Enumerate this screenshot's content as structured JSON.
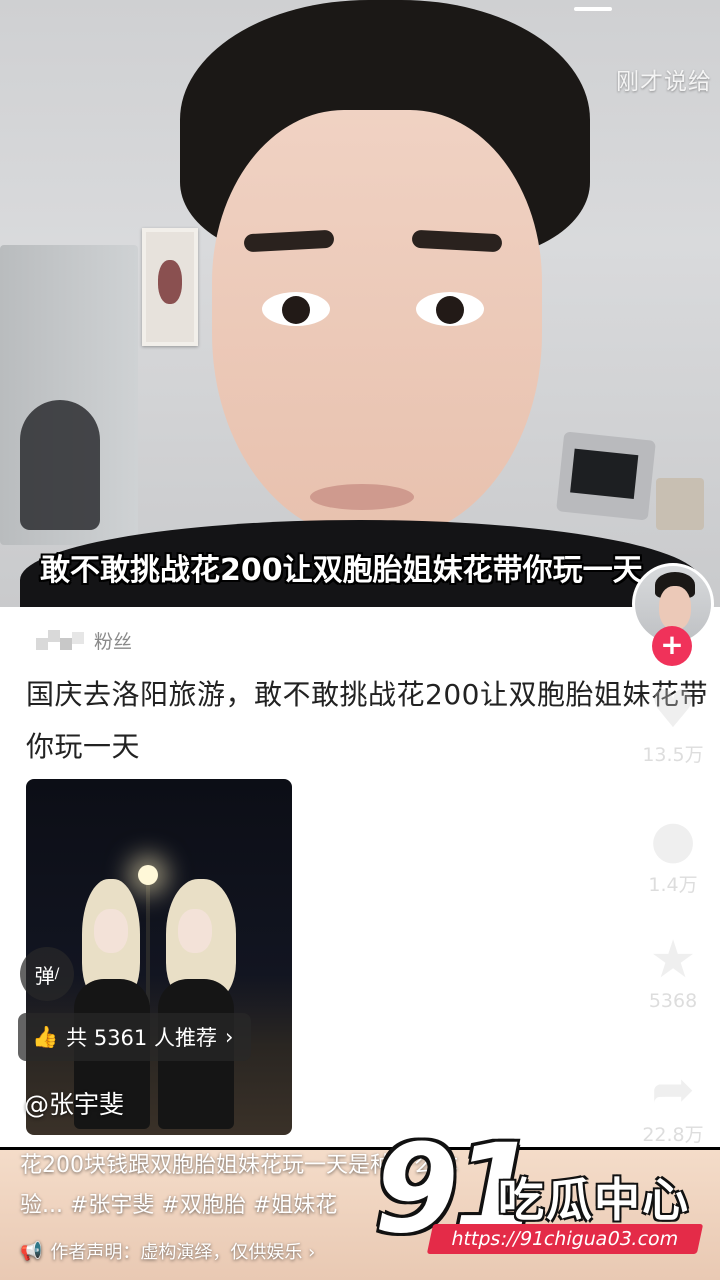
{
  "video": {
    "top_hint": "刚才说给",
    "subtitle": "敢不敢挑战花200让双胞胎姐妹花带你玩一天"
  },
  "comment_card": {
    "user_tag": "粉丝",
    "text": "国庆去洛阳旅游，敢不敢挑战花200让双胞胎姐妹花带你玩一天",
    "thumbnail": {
      "danmaku_label": "弹",
      "recommend_label": "共 5361 人推荐",
      "recommend_arrow": "›",
      "at_user": "@张宇斐"
    }
  },
  "side_actions": {
    "follow_icon": "+",
    "like": {
      "icon": "heart-icon",
      "glyph": "♥",
      "count": "13.5万"
    },
    "comment": {
      "icon": "comment-icon",
      "glyph": "●",
      "count": "1.4万"
    },
    "favorite": {
      "icon": "star-icon",
      "glyph": "★",
      "count": "5368"
    },
    "share": {
      "icon": "share-icon",
      "glyph": "➦",
      "count": "22.8万"
    }
  },
  "description": {
    "line1": "花200块钱跟双胞胎姐妹花玩一天是种什么体",
    "line2": "验... #张宇斐 #双胞胎 #姐妹花",
    "disclaimer": "作者声明：虚构演绎，仅供娱乐 ›"
  },
  "watermark": {
    "big": "91",
    "cn": "吃瓜中心",
    "url": "https://91chigua03.com"
  }
}
